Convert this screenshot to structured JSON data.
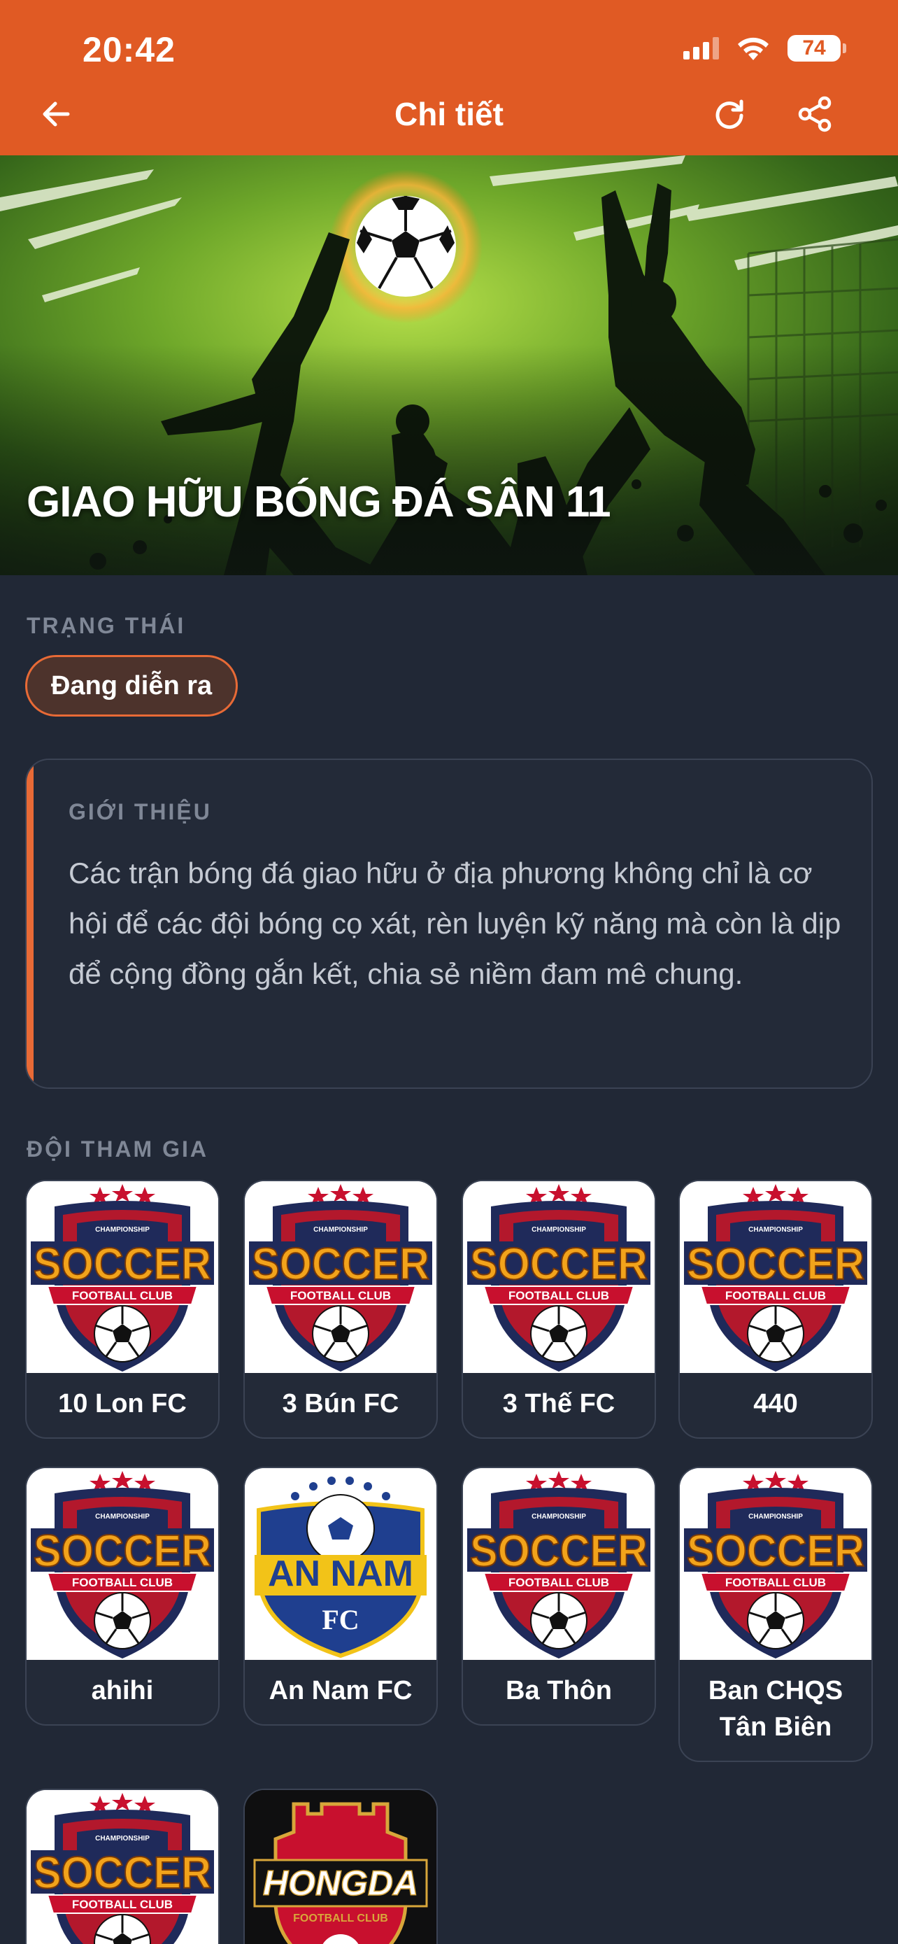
{
  "status_bar": {
    "time": "20:42",
    "battery": "74"
  },
  "header": {
    "title": "Chi tiết"
  },
  "hero": {
    "title": "GIAO HỮU BÓNG ĐÁ SÂN 11"
  },
  "status_section": {
    "label": "TRẠNG THÁI",
    "value": "Đang diễn ra"
  },
  "intro": {
    "label": "GIỚI THIỆU",
    "text": "Các trận bóng đá giao hữu ở địa phương không chỉ là cơ hội để các đội bóng cọ xát, rèn luyện kỹ năng mà còn là dịp để cộng đồng gắn kết, chia sẻ niềm đam mê chung."
  },
  "teams_section": {
    "label": "ĐỘI THAM GIA",
    "teams": [
      {
        "name": "10 Lon FC",
        "logo": "soccer-badge"
      },
      {
        "name": "3 Bún FC",
        "logo": "soccer-badge"
      },
      {
        "name": "3 Thế FC",
        "logo": "soccer-badge"
      },
      {
        "name": "440",
        "logo": "soccer-badge"
      },
      {
        "name": "ahihi",
        "logo": "soccer-badge"
      },
      {
        "name": "An Nam FC",
        "logo": "an-nam-badge"
      },
      {
        "name": "Ba Thôn",
        "logo": "soccer-badge"
      },
      {
        "name": "Ban CHQS Tân Biên",
        "logo": "soccer-badge"
      },
      {
        "name": "",
        "logo": "soccer-badge"
      },
      {
        "name": "",
        "logo": "hongda-badge"
      }
    ]
  },
  "logo_text": {
    "soccer_top": "CHAMPIONSHIP",
    "soccer_main": "SOCCER",
    "soccer_sub": "FOOTBALL CLUB",
    "annam_main": "AN NAM",
    "annam_sub": "FC",
    "hongda_main": "HONGDA",
    "hongda_sub": "FOOTBALL CLUB"
  },
  "colors": {
    "accent": "#e05a24",
    "background": "#212836",
    "card_border": "#3b4354",
    "pill_bg": "#4d332c"
  },
  "icons": {
    "back": "arrow-left-icon",
    "refresh": "refresh-icon",
    "share": "share-icon"
  }
}
